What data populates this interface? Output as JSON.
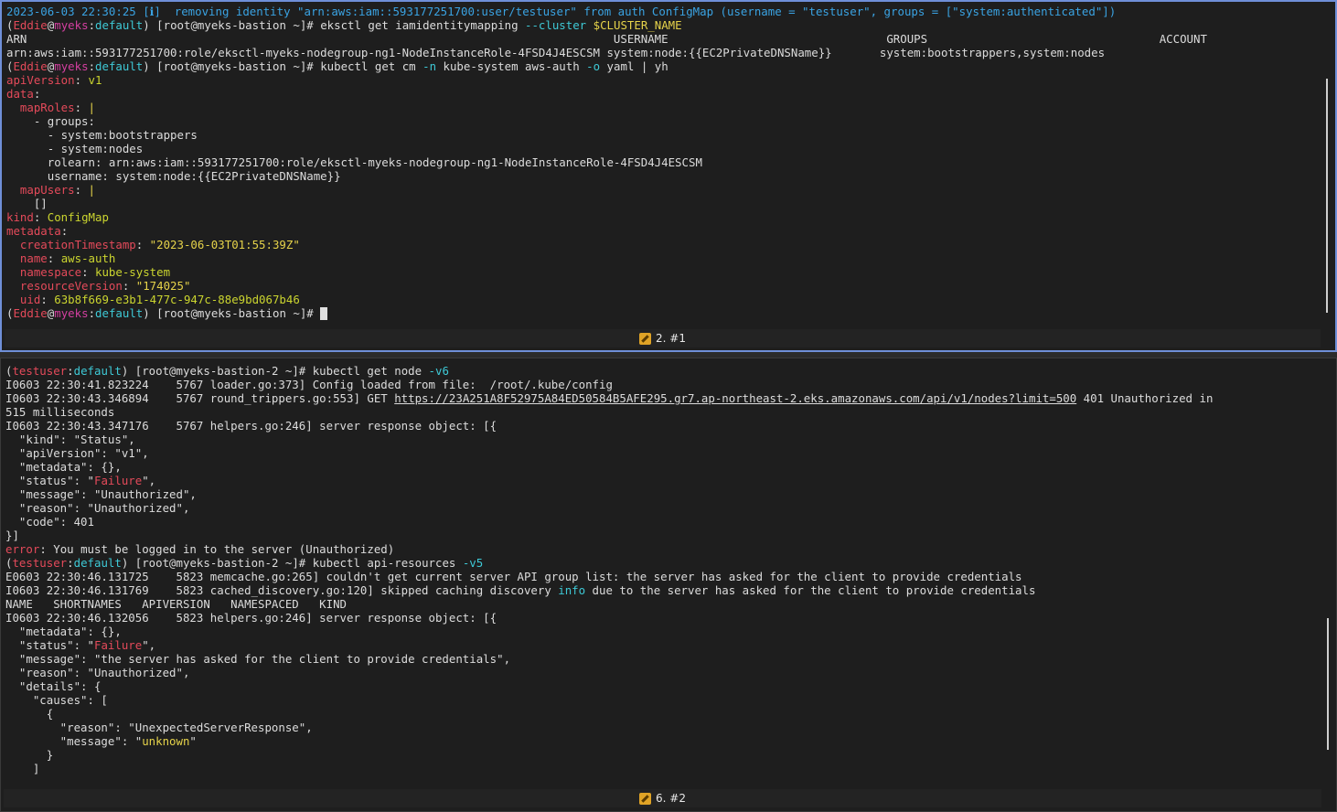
{
  "top_pane": {
    "label": "2. #1",
    "lines": [
      [
        {
          "t": "2023-06-03 22:30:25 [ℹ]  removing identity \"arn:aws:iam::593177251700:user/testuser\" from auth ConfigMap (username = \"testuser\", groups = [\"system:authenticated\"])",
          "c": "blue"
        }
      ],
      [
        {
          "t": "(",
          "c": "wht"
        },
        {
          "t": "Eddie",
          "c": "red"
        },
        {
          "t": "@",
          "c": "wht"
        },
        {
          "t": "myeks",
          "c": "mag"
        },
        {
          "t": ":",
          "c": "wht"
        },
        {
          "t": "default",
          "c": "cyan"
        },
        {
          "t": ") [root@myeks-bastion ~]# eksctl get iamidentitymapping ",
          "c": "wht"
        },
        {
          "t": "--cluster",
          "c": "cyan"
        },
        {
          "t": " ",
          "c": "wht"
        },
        {
          "t": "$CLUSTER_NAME",
          "c": "yel"
        }
      ],
      [
        {
          "t": "ARN                                                                                      USERNAME                                GROUPS                                  ACCOUNT",
          "c": "wht"
        }
      ],
      [
        {
          "t": "arn:aws:iam::593177251700:role/eksctl-myeks-nodegroup-ng1-NodeInstanceRole-4FSD4J4ESCSM system:node:{{EC2PrivateDNSName}}       system:bootstrappers,system:nodes",
          "c": "wht"
        }
      ],
      [
        {
          "t": "(",
          "c": "wht"
        },
        {
          "t": "Eddie",
          "c": "red"
        },
        {
          "t": "@",
          "c": "wht"
        },
        {
          "t": "myeks",
          "c": "mag"
        },
        {
          "t": ":",
          "c": "wht"
        },
        {
          "t": "default",
          "c": "cyan"
        },
        {
          "t": ") [root@myeks-bastion ~]# kubectl get cm ",
          "c": "wht"
        },
        {
          "t": "-n",
          "c": "cyan"
        },
        {
          "t": " kube-system aws-auth ",
          "c": "wht"
        },
        {
          "t": "-o",
          "c": "cyan"
        },
        {
          "t": " yaml | yh",
          "c": "wht"
        }
      ],
      [
        {
          "t": "apiVersion",
          "c": "red"
        },
        {
          "t": ": ",
          "c": "wht"
        },
        {
          "t": "v1",
          "c": "grn"
        }
      ],
      [
        {
          "t": "data",
          "c": "red"
        },
        {
          "t": ":",
          "c": "wht"
        }
      ],
      [
        {
          "t": "  ",
          "c": "wht"
        },
        {
          "t": "mapRoles",
          "c": "red"
        },
        {
          "t": ": ",
          "c": "wht"
        },
        {
          "t": "|",
          "c": "yel"
        }
      ],
      [
        {
          "t": "    - groups:",
          "c": "wht"
        }
      ],
      [
        {
          "t": "      - system:bootstrappers",
          "c": "wht"
        }
      ],
      [
        {
          "t": "      - system:nodes",
          "c": "wht"
        }
      ],
      [
        {
          "t": "      rolearn: arn:aws:iam::593177251700:role/eksctl-myeks-nodegroup-ng1-NodeInstanceRole-4FSD4J4ESCSM",
          "c": "wht"
        }
      ],
      [
        {
          "t": "      username: system:node:{{EC2PrivateDNSName}}",
          "c": "wht"
        }
      ],
      [
        {
          "t": "  ",
          "c": "wht"
        },
        {
          "t": "mapUsers",
          "c": "red"
        },
        {
          "t": ": ",
          "c": "wht"
        },
        {
          "t": "|",
          "c": "yel"
        }
      ],
      [
        {
          "t": "    []",
          "c": "wht"
        }
      ],
      [
        {
          "t": "kind",
          "c": "red"
        },
        {
          "t": ": ",
          "c": "wht"
        },
        {
          "t": "ConfigMap",
          "c": "grn"
        }
      ],
      [
        {
          "t": "metadata",
          "c": "red"
        },
        {
          "t": ":",
          "c": "wht"
        }
      ],
      [
        {
          "t": "  ",
          "c": "wht"
        },
        {
          "t": "creationTimestamp",
          "c": "red"
        },
        {
          "t": ": ",
          "c": "wht"
        },
        {
          "t": "\"2023-06-03T01:55:39Z\"",
          "c": "yel"
        }
      ],
      [
        {
          "t": "  ",
          "c": "wht"
        },
        {
          "t": "name",
          "c": "red"
        },
        {
          "t": ": ",
          "c": "wht"
        },
        {
          "t": "aws-auth",
          "c": "grn"
        }
      ],
      [
        {
          "t": "  ",
          "c": "wht"
        },
        {
          "t": "namespace",
          "c": "red"
        },
        {
          "t": ": ",
          "c": "wht"
        },
        {
          "t": "kube-system",
          "c": "grn"
        }
      ],
      [
        {
          "t": "  ",
          "c": "wht"
        },
        {
          "t": "resourceVersion",
          "c": "red"
        },
        {
          "t": ": ",
          "c": "wht"
        },
        {
          "t": "\"174025\"",
          "c": "yel"
        }
      ],
      [
        {
          "t": "  ",
          "c": "wht"
        },
        {
          "t": "uid",
          "c": "red"
        },
        {
          "t": ": ",
          "c": "wht"
        },
        {
          "t": "63b8f669-e3b1-477c-947c-88e9bd067b46",
          "c": "grn"
        }
      ],
      [
        {
          "t": "(",
          "c": "wht"
        },
        {
          "t": "Eddie",
          "c": "red"
        },
        {
          "t": "@",
          "c": "wht"
        },
        {
          "t": "myeks",
          "c": "mag"
        },
        {
          "t": ":",
          "c": "wht"
        },
        {
          "t": "default",
          "c": "cyan"
        },
        {
          "t": ") [root@myeks-bastion ~]# ",
          "c": "wht"
        },
        {
          "t": "",
          "c": "cursor"
        }
      ]
    ]
  },
  "bottom_pane": {
    "label": "6. #2",
    "lines": [
      [
        {
          "t": "(",
          "c": "wht"
        },
        {
          "t": "testuser",
          "c": "red"
        },
        {
          "t": ":",
          "c": "wht"
        },
        {
          "t": "default",
          "c": "cyan"
        },
        {
          "t": ") [root@myeks-bastion-2 ~]# kubectl get node ",
          "c": "wht"
        },
        {
          "t": "-v6",
          "c": "cyan"
        }
      ],
      [
        {
          "t": "I0603 22:30:41.823224    5767 loader.go:373] Config loaded from file:  /root/.kube/config",
          "c": "wht"
        }
      ],
      [
        {
          "t": "I0603 22:30:43.346894    5767 round_trippers.go:553] GET ",
          "c": "wht"
        },
        {
          "t": "https://23A251A8F52975A84ED50584B5AFE295.gr7.ap-northeast-2.eks.amazonaws.com/api/v1/nodes?limit=500",
          "c": "wht ul"
        },
        {
          "t": " 401 Unauthorized in",
          "c": "wht"
        }
      ],
      [
        {
          "t": "515 milliseconds",
          "c": "wht"
        }
      ],
      [
        {
          "t": "I0603 22:30:43.347176    5767 helpers.go:246] server response object: [{",
          "c": "wht"
        }
      ],
      [
        {
          "t": "  \"kind\": \"Status\",",
          "c": "wht"
        }
      ],
      [
        {
          "t": "  \"apiVersion\": \"v1\",",
          "c": "wht"
        }
      ],
      [
        {
          "t": "  \"metadata\": {},",
          "c": "wht"
        }
      ],
      [
        {
          "t": "  \"status\": \"",
          "c": "wht"
        },
        {
          "t": "Failure",
          "c": "red"
        },
        {
          "t": "\",",
          "c": "wht"
        }
      ],
      [
        {
          "t": "  \"message\": \"Unauthorized\",",
          "c": "wht"
        }
      ],
      [
        {
          "t": "  \"reason\": \"Unauthorized\",",
          "c": "wht"
        }
      ],
      [
        {
          "t": "  \"code\": 401",
          "c": "wht"
        }
      ],
      [
        {
          "t": "}]",
          "c": "wht"
        }
      ],
      [
        {
          "t": "error",
          "c": "red"
        },
        {
          "t": ": You must be logged in to the server (Unauthorized)",
          "c": "wht"
        }
      ],
      [
        {
          "t": "(",
          "c": "wht"
        },
        {
          "t": "testuser",
          "c": "red"
        },
        {
          "t": ":",
          "c": "wht"
        },
        {
          "t": "default",
          "c": "cyan"
        },
        {
          "t": ") [root@myeks-bastion-2 ~]# kubectl api-resources ",
          "c": "wht"
        },
        {
          "t": "-v5",
          "c": "cyan"
        }
      ],
      [
        {
          "t": "E0603 22:30:46.131725    5823 memcache.go:265] couldn't get current server API group list: the server has asked for the client to provide credentials",
          "c": "wht"
        }
      ],
      [
        {
          "t": "I0603 22:30:46.131769    5823 cached_discovery.go:120] skipped caching discovery ",
          "c": "wht"
        },
        {
          "t": "info",
          "c": "cyan"
        },
        {
          "t": " due to the server has asked for the client to provide credentials",
          "c": "wht"
        }
      ],
      [
        {
          "t": "NAME   SHORTNAMES   APIVERSION   NAMESPACED   KIND",
          "c": "wht"
        }
      ],
      [
        {
          "t": "I0603 22:30:46.132056    5823 helpers.go:246] server response object: [{",
          "c": "wht"
        }
      ],
      [
        {
          "t": "  \"metadata\": {},",
          "c": "wht"
        }
      ],
      [
        {
          "t": "  \"status\": \"",
          "c": "wht"
        },
        {
          "t": "Failure",
          "c": "red"
        },
        {
          "t": "\",",
          "c": "wht"
        }
      ],
      [
        {
          "t": "  \"message\": \"the server has asked for the client to provide credentials\",",
          "c": "wht"
        }
      ],
      [
        {
          "t": "  \"reason\": \"Unauthorized\",",
          "c": "wht"
        }
      ],
      [
        {
          "t": "  \"details\": {",
          "c": "wht"
        }
      ],
      [
        {
          "t": "    \"causes\": [",
          "c": "wht"
        }
      ],
      [
        {
          "t": "      {",
          "c": "wht"
        }
      ],
      [
        {
          "t": "        \"reason\": \"UnexpectedServerResponse\",",
          "c": "wht"
        }
      ],
      [
        {
          "t": "        \"message\": \"",
          "c": "wht"
        },
        {
          "t": "unknown",
          "c": "yel"
        },
        {
          "t": "\"",
          "c": "wht"
        }
      ],
      [
        {
          "t": "      }",
          "c": "wht"
        }
      ],
      [
        {
          "t": "    ]",
          "c": "wht"
        }
      ]
    ]
  }
}
